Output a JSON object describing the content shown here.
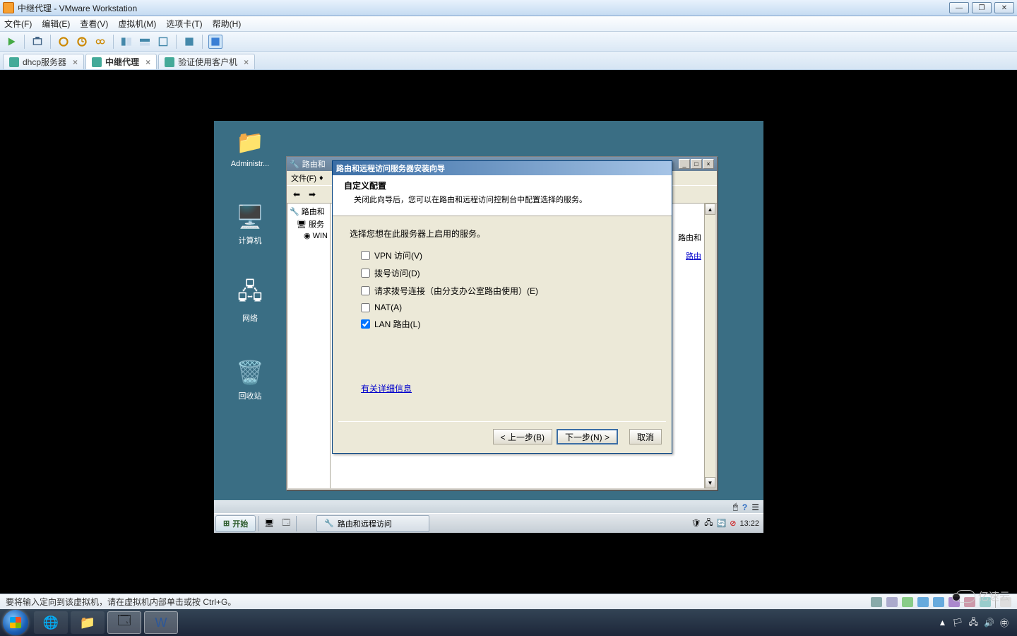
{
  "vmware": {
    "title": "中继代理 - VMware Workstation",
    "menu": {
      "file": "文件(F)",
      "edit": "编辑(E)",
      "view": "查看(V)",
      "vm": "虚拟机(M)",
      "tabs": "选项卡(T)",
      "help": "帮助(H)"
    },
    "tabs": [
      {
        "label": "dhcp服务器"
      },
      {
        "label": "中继代理"
      },
      {
        "label": "验证使用客户机"
      }
    ],
    "status": "要将输入定向到该虚拟机，请在虚拟机内部单击或按 Ctrl+G。"
  },
  "guest": {
    "icons": {
      "admin": "Administr...",
      "computer": "计算机",
      "network": "网络",
      "recycle": "回收站"
    },
    "mmc": {
      "title_prefix": "路由和",
      "menu_file": "文件(F)",
      "tree": {
        "root": "路由和",
        "server": "服务",
        "win": "WIN"
      },
      "content_snippet1": "路由和",
      "content_link": "路由"
    },
    "wizard": {
      "title": "路由和远程访问服务器安装向导",
      "header": "自定义配置",
      "subheader": "关闭此向导后，您可以在路由和远程访问控制台中配置选择的服务。",
      "prompt": "选择您想在此服务器上启用的服务。",
      "options": {
        "vpn": "VPN 访问(V)",
        "dial": "拨号访问(D)",
        "demand": "请求拨号连接（由分支办公室路由使用）(E)",
        "nat": "NAT(A)",
        "lan": "LAN 路由(L)"
      },
      "checked": {
        "vpn": false,
        "dial": false,
        "demand": false,
        "nat": false,
        "lan": true
      },
      "more_link": "有关详细信息",
      "buttons": {
        "back": "< 上一步(B)",
        "next": "下一步(N) >",
        "cancel": "取消"
      }
    },
    "taskbar": {
      "start": "开始",
      "task": "路由和远程访问",
      "clock": "13:22"
    }
  },
  "host": {
    "watermark": "亿速云"
  }
}
